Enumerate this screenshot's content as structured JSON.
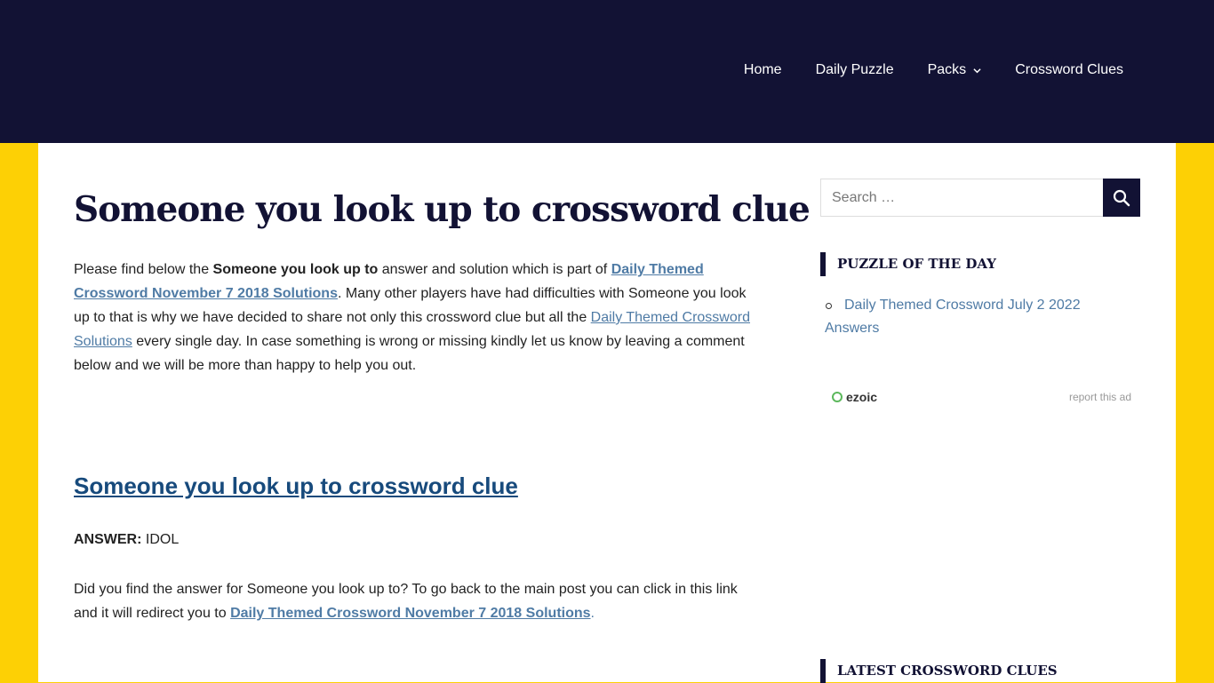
{
  "nav": {
    "items": [
      {
        "label": "Home"
      },
      {
        "label": "Daily Puzzle"
      },
      {
        "label": "Packs",
        "has_dropdown": true
      },
      {
        "label": "Crossword Clues"
      }
    ]
  },
  "main": {
    "title": "Someone you look up to crossword clue",
    "intro": {
      "t1": "Please find below the ",
      "bold_clue": "Someone you look up to",
      "t2": " answer and solution which is part of ",
      "link1": "Daily Themed Crossword November 7 2018 Solutions",
      "t3": ". Many other players have had difficulties with Someone you look up to that is why we have decided to share not only this crossword clue but all the ",
      "link2": "Daily Themed Crossword Solutions",
      "t4": " every single day. In case something is wrong or missing kindly let us know by leaving a comment below and we will be more than happy to help you out."
    },
    "clue_heading": "Someone you look up to crossword clue",
    "answer_label": "ANSWER:",
    "answer_value": "IDOL",
    "closing": {
      "t1": "Did you find the answer for Someone you look up to? To go back to the main post you can click in this link and it will redirect you to ",
      "link": "Daily Themed Crossword November 7 2018 Solutions",
      "t2": "."
    }
  },
  "sidebar": {
    "search": {
      "placeholder": "Search …",
      "button_icon": "search-icon"
    },
    "puzzle_of_day": {
      "title": "PUZZLE OF THE DAY",
      "items": [
        {
          "label": "Daily Themed Crossword July 2 2022 Answers"
        }
      ]
    },
    "ad": {
      "brand": "ezoic",
      "report": "report this ad"
    },
    "latest": {
      "title": "LATEST CROSSWORD CLUES"
    }
  },
  "colors": {
    "header": "#121234",
    "accent": "#fdd005",
    "link": "#4f7ba5"
  }
}
